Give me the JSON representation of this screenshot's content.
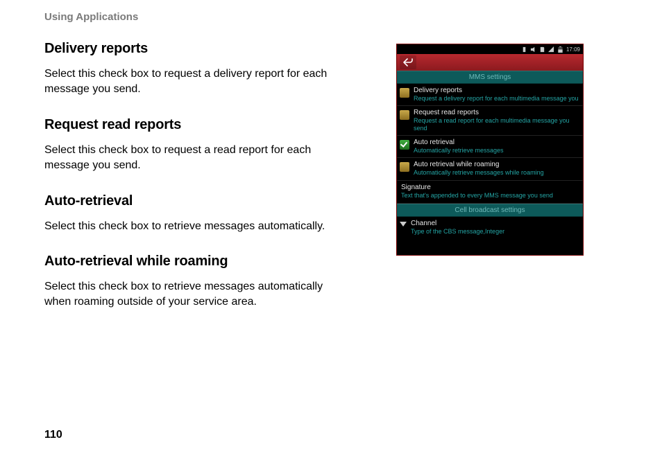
{
  "header": "Using Applications",
  "pageNumber": "110",
  "sections": [
    {
      "title": "Delivery reports",
      "body": "Select this check box to request a delivery report for each message you send."
    },
    {
      "title": "Request read reports",
      "body": "Select this check box to request a read report for each message you send."
    },
    {
      "title": "Auto-retrieval",
      "body": "Select this check box to retrieve messages automatically."
    },
    {
      "title": "Auto-retrieval while roaming",
      "body": "Select this check box to retrieve messages automatically when roaming outside of your service area."
    }
  ],
  "phone": {
    "status_time": "17:09",
    "section1": "MMS settings",
    "rows": [
      {
        "title": "Delivery reports",
        "sub": "Request a delivery report for each multimedia message you"
      },
      {
        "title": "Request read reports",
        "sub": "Request a read report for each multimedia message you send"
      },
      {
        "title": "Auto retrieval",
        "sub": "Automatically retrieve messages"
      },
      {
        "title": "Auto retrieval while roaming",
        "sub": "Automatically retrieve messages while roaming"
      }
    ],
    "signature": {
      "title": "Signature",
      "sub": "Text that's appended to every MMS message you send"
    },
    "section2": "Cell broadcast settings",
    "channel": {
      "title": "Channel",
      "sub": "Type of the CBS message,Integer"
    }
  }
}
